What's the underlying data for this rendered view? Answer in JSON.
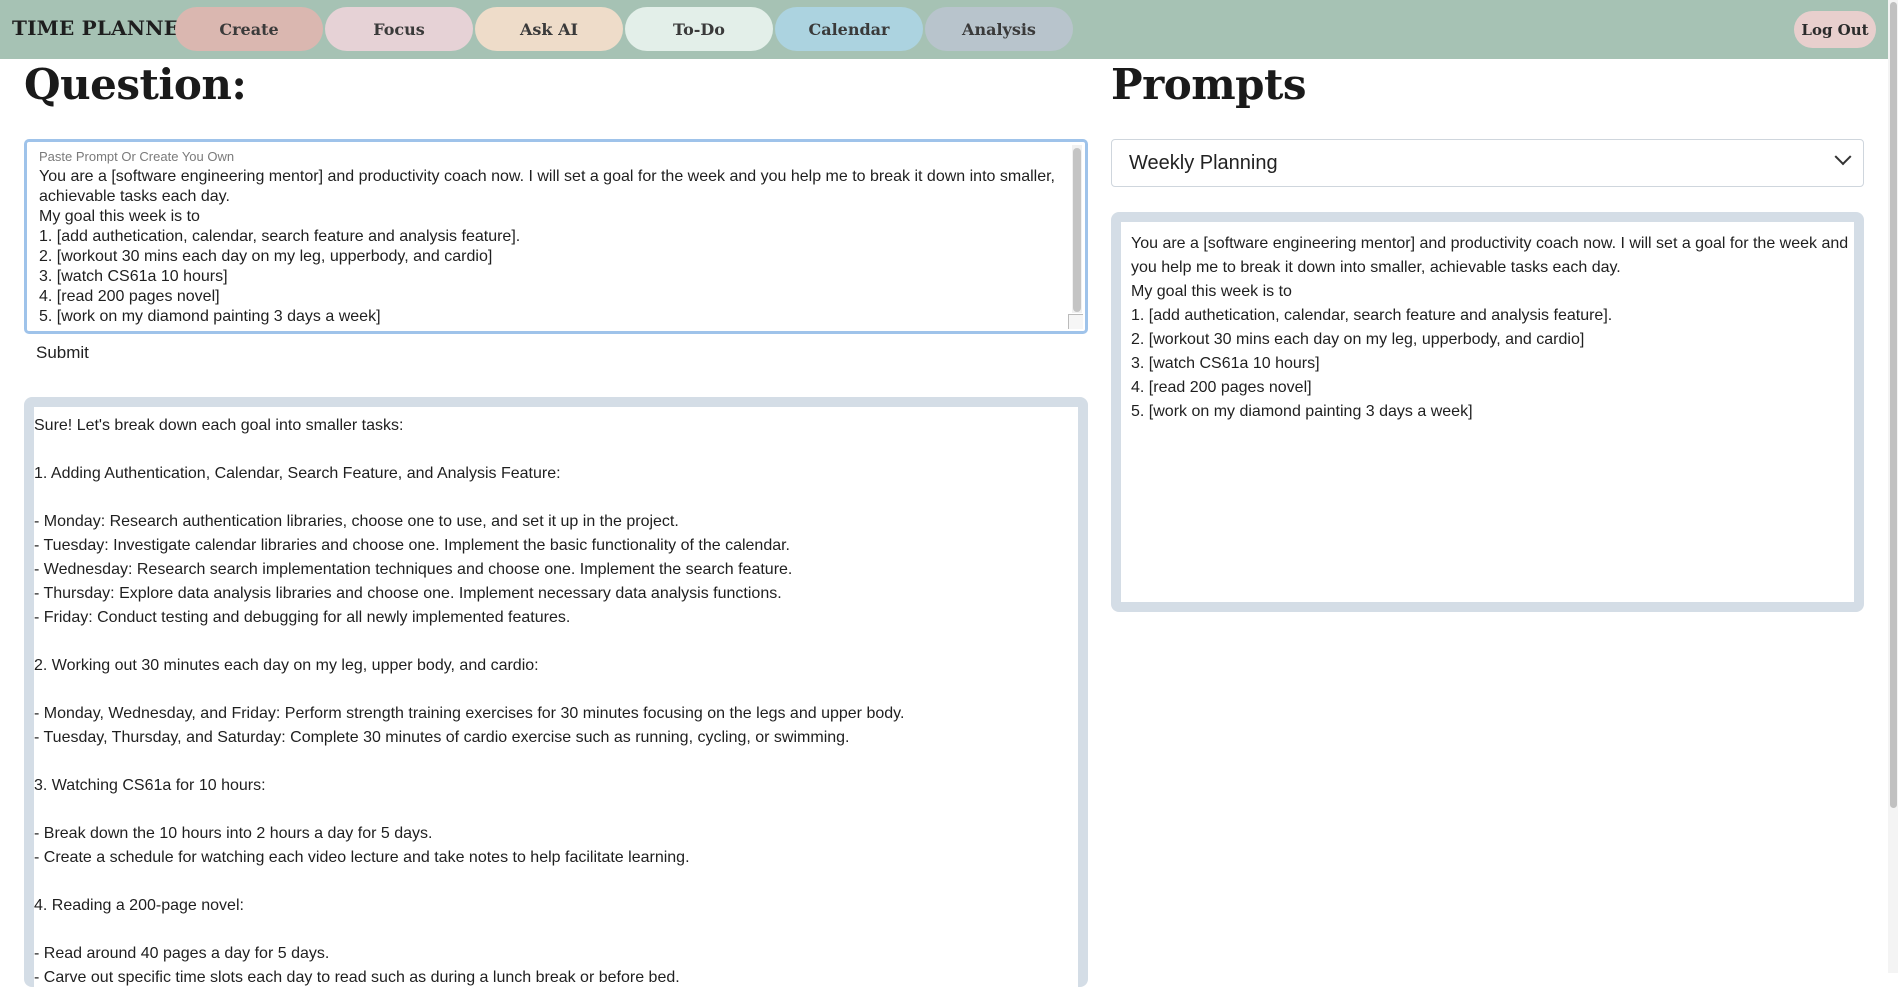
{
  "app": {
    "title": "TIME PLANNER",
    "logout_label": "Log Out"
  },
  "nav": {
    "tabs": [
      {
        "label": "Create",
        "color": "#dab7b0"
      },
      {
        "label": "Focus",
        "color": "#e6d2d6"
      },
      {
        "label": "Ask AI",
        "color": "#eedcc9"
      },
      {
        "label": "To-Do",
        "color": "#e3efe9"
      },
      {
        "label": "Calendar",
        "color": "#acd3e0"
      },
      {
        "label": "Analysis",
        "color": "#b8c4cc"
      }
    ]
  },
  "question": {
    "heading": "Question:",
    "placeholder": "Paste Prompt Or Create You Own",
    "value": "You are a [software engineering mentor] and productivity coach now. I will set a goal for the week and you help me to break it down into smaller, achievable tasks each day.\nMy goal this week is to\n1. [add authetication, calendar, search feature and analysis feature].\n2. [workout 30 mins each day on my leg, upperbody, and cardio]\n3. [watch CS61a 10 hours]\n4. [read 200 pages novel]\n5. [work on my diamond painting 3 days a week]",
    "submit_label": "Submit"
  },
  "answer": {
    "lines": [
      "Sure! Let's break down each goal into smaller tasks:",
      "",
      "1. Adding Authentication, Calendar, Search Feature, and Analysis Feature:",
      "",
      "- Monday: Research authentication libraries, choose one to use, and set it up in the project.",
      "- Tuesday: Investigate calendar libraries and choose one. Implement the basic functionality of the calendar.",
      "- Wednesday: Research search implementation techniques and choose one. Implement the search feature.",
      "- Thursday: Explore data analysis libraries and choose one. Implement necessary data analysis functions.",
      "- Friday: Conduct testing and debugging for all newly implemented features.",
      "",
      "2. Working out 30 minutes each day on my leg, upper body, and cardio:",
      "",
      "- Monday, Wednesday, and Friday: Perform strength training exercises for 30 minutes focusing on the legs and upper body.",
      "- Tuesday, Thursday, and Saturday: Complete 30 minutes of cardio exercise such as running, cycling, or swimming.",
      "",
      "3. Watching CS61a for 10 hours:",
      "",
      "- Break down the 10 hours into 2 hours a day for 5 days.",
      "- Create a schedule for watching each video lecture and take notes to help facilitate learning.",
      "",
      "4. Reading a 200-page novel:",
      "",
      "- Read around 40 pages a day for 5 days.",
      "- Carve out specific time slots each day to read such as during a lunch break or before bed."
    ]
  },
  "prompts": {
    "heading": "Prompts",
    "selected": "Weekly Planning",
    "text": "You are a [software engineering mentor] and productivity coach now. I will set a goal for the week and you help me to break it down into smaller, achievable tasks each day.\nMy goal this week is to\n1. [add authetication, calendar, search feature and analysis feature].\n2. [workout 30 mins each day on my leg, upperbody, and cardio]\n3. [watch CS61a 10 hours]\n4. [read 200 pages novel]\n5. [work on my diamond painting 3 days a week]"
  },
  "colors": {
    "navbar": "#a6c2b4",
    "panel_frame": "#d4dde6",
    "focus_border": "#9fc3ea"
  }
}
